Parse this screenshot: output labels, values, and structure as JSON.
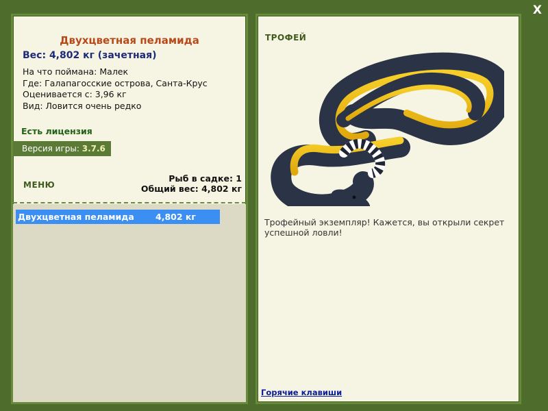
{
  "window": {
    "close_label": "X"
  },
  "fish": {
    "name": "Двухцветная пеламида",
    "weight": "Вес: 4,802 кг (зачетная)",
    "caught_on": "На что поймана: Малек",
    "location": "Где: Галапагосские острова, Санта-Крус",
    "rated_from": "Оценивается с: 3,96 кг",
    "rarity": "Вид: Ловится очень редко"
  },
  "license": "Есть лицензия",
  "version": {
    "label": "Версия игры:",
    "value": "3.7.6"
  },
  "menu": {
    "title": "МЕНЮ",
    "fish_in_keepnet": "Рыб в садке: 1",
    "total_weight": "Общий вес: 4,802 кг"
  },
  "catch_list": [
    {
      "name": "Двухцветная пеламида",
      "weight": "4,802 кг"
    }
  ],
  "trophy": {
    "title": "ТРОФЕЙ",
    "image_icon": "sea-snake-image",
    "text": "Трофейный экземпляр! Кажется, вы открыли секрет успешной ловли!"
  },
  "footer": {
    "hotkeys_link": "Горячие клавиши"
  },
  "colors": {
    "frame_green": "#4e6c2b",
    "panel_bg": "#f6f4e2",
    "title_orange": "#b74a1c",
    "weight_blue": "#1e2a7a",
    "selection_blue": "#3b8ef2",
    "link_blue": "#0a1d9a"
  }
}
